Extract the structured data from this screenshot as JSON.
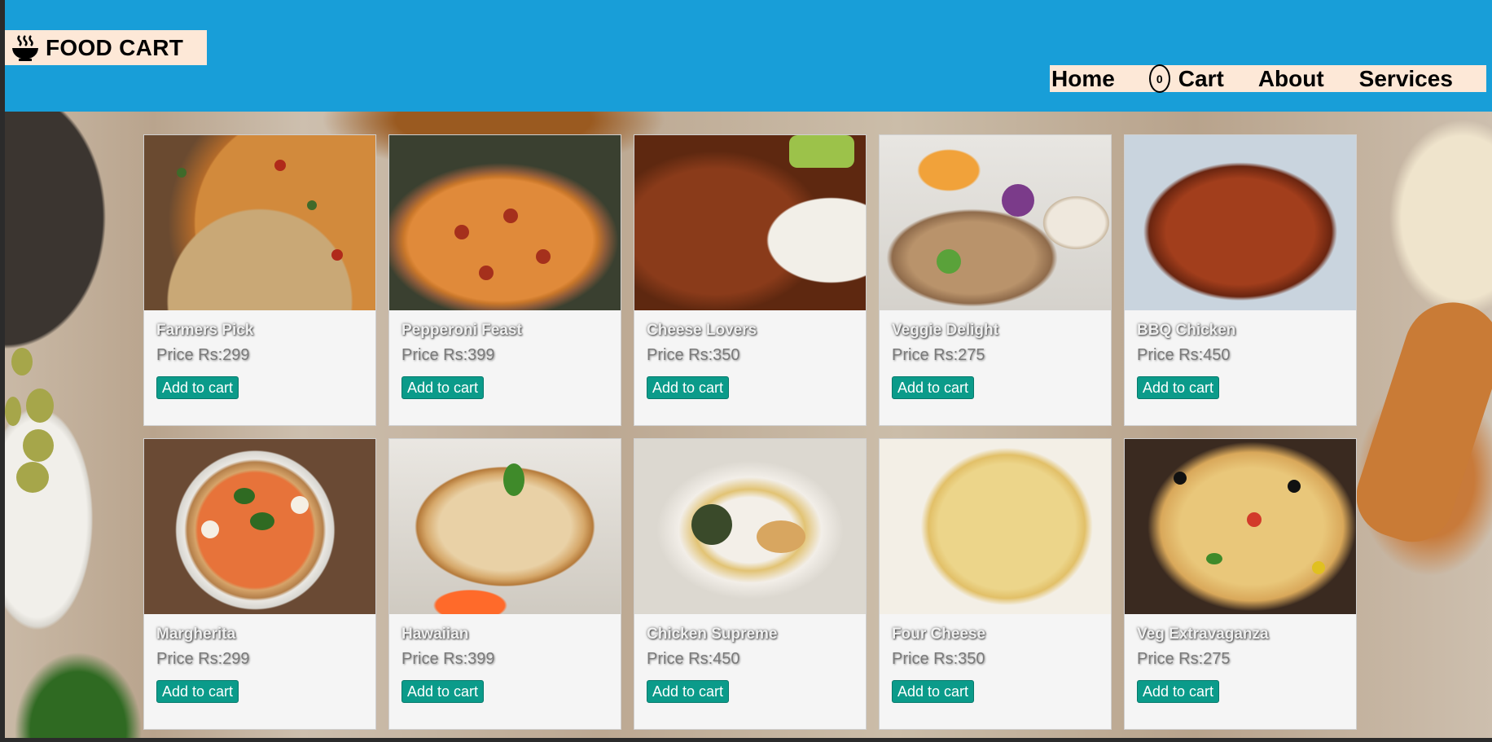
{
  "header": {
    "brand_title": "FOOD CART",
    "brand_icon": "bowl-steam-icon",
    "bg_color": "#189ed8",
    "nav_bg_color": "#fde8d7",
    "nav": {
      "home": "Home",
      "cart_count": "0",
      "cart": "Cart",
      "about": "About",
      "services": "Services"
    }
  },
  "products": [
    {
      "name": "Farmers Pick",
      "price": "Price Rs:299",
      "button": "Add to cart",
      "image": "pizza"
    },
    {
      "name": "Pepperoni Feast",
      "price": "Price Rs:399",
      "button": "Add to cart",
      "image": "pizza"
    },
    {
      "name": "Cheese Lovers",
      "price": "Price Rs:350",
      "button": "Add to cart",
      "image": "chicken-wings"
    },
    {
      "name": "Veggie Delight",
      "price": "Price Rs:275",
      "button": "Add to cart",
      "image": "wraps"
    },
    {
      "name": "BBQ Chicken",
      "price": "Price Rs:450",
      "button": "Add to cart",
      "image": "grilled-chicken"
    },
    {
      "name": "Margherita",
      "price": "Price Rs:299",
      "button": "Add to cart",
      "image": "pizza"
    },
    {
      "name": "Hawaiian",
      "price": "Price Rs:399",
      "button": "Add to cart",
      "image": "pineapple-rice"
    },
    {
      "name": "Chicken Supreme",
      "price": "Price Rs:450",
      "button": "Add to cart",
      "image": "plated-chicken"
    },
    {
      "name": "Four Cheese",
      "price": "Price Rs:350",
      "button": "Add to cart",
      "image": "baked-pasta"
    },
    {
      "name": "Veg Extravaganza",
      "price": "Price Rs:275",
      "button": "Add to cart",
      "image": "veg-pizza"
    }
  ],
  "colors": {
    "button_bg": "#0b9b8a",
    "card_bg": "#f5f5f5"
  }
}
